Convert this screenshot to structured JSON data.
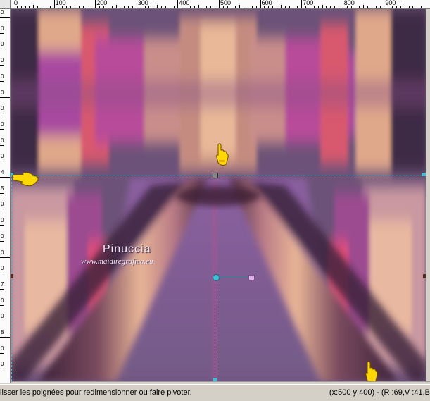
{
  "ruler_top": {
    "labels": [
      "0",
      "100",
      "200",
      "300",
      "400",
      "500",
      "600",
      "700",
      "800",
      "900"
    ]
  },
  "ruler_left": {
    "labels": [
      "0",
      "0",
      "0",
      "0",
      "0",
      "0",
      "0",
      "0",
      "0",
      "0",
      "4",
      "5",
      "0",
      "0",
      "0",
      "0",
      "0",
      "7",
      "0",
      "0",
      "8",
      "0",
      "0"
    ]
  },
  "watermark": {
    "name": "Pinuccia",
    "url": "www.maidiregrafica.eu"
  },
  "status": {
    "hint": "lisser les poignées pour redimensionner ou faire pivoter.",
    "info": "(x:500 y:400) - (R :69,V :41,B"
  },
  "colors": {
    "guide": "#3cc0d8",
    "pointer_hand": "#ffd800",
    "canvas_base": "#6a4d78",
    "accent_pink": "#e8406a",
    "accent_magenta": "#b34aa8"
  },
  "icons": {
    "pointer": "pointing-hand-icon",
    "handle": "transform-handle-icon"
  }
}
